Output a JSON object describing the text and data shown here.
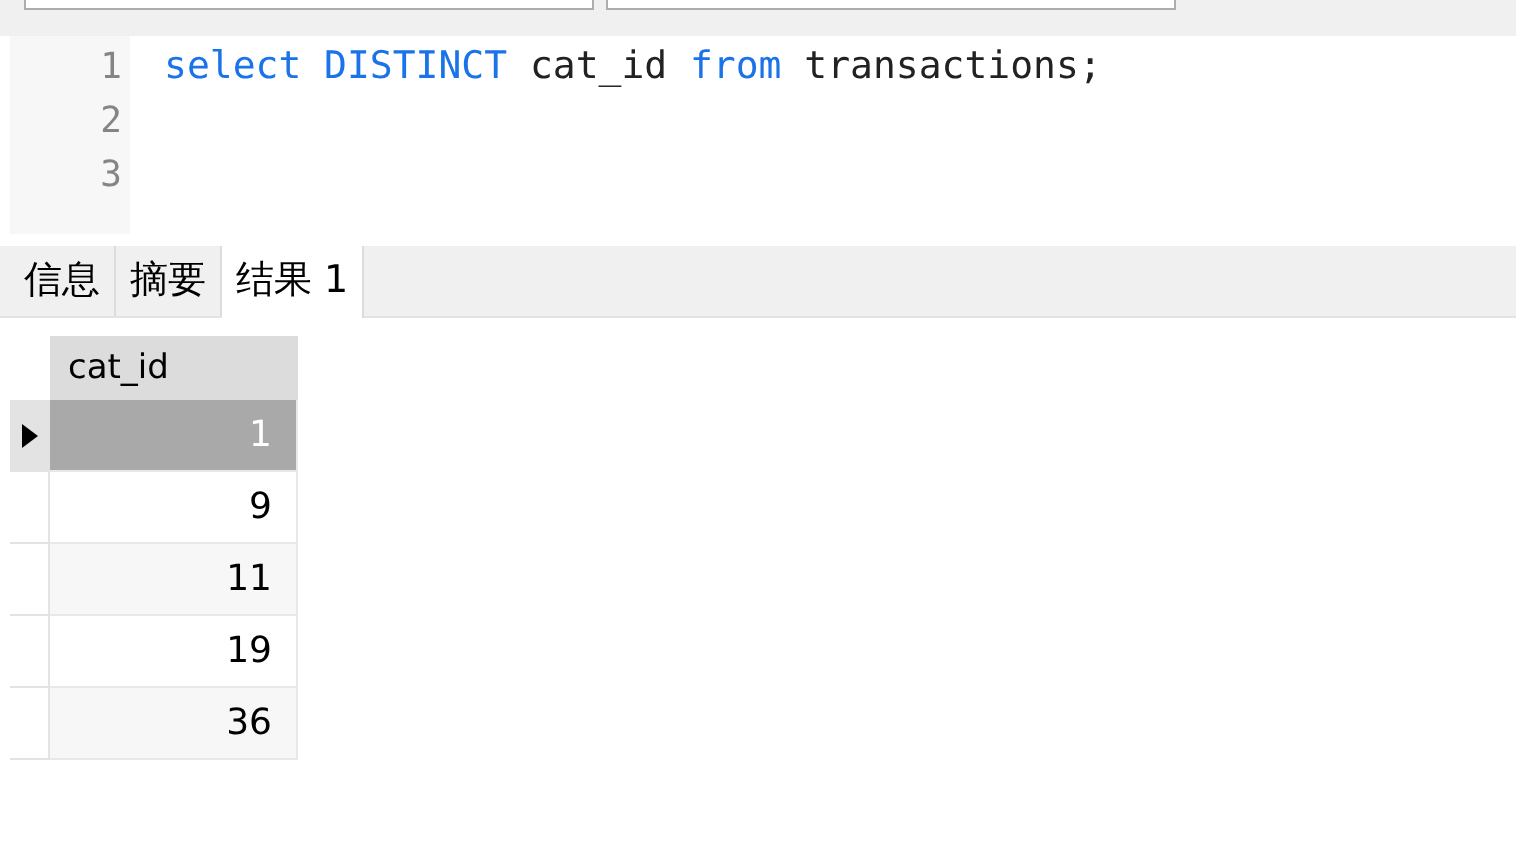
{
  "editor": {
    "lines": [
      {
        "number": "1",
        "tokens": [
          {
            "text": "select",
            "kind": "keyword"
          },
          {
            "text": "DISTINCT",
            "kind": "keyword"
          },
          {
            "text": "cat_id",
            "kind": "plain"
          },
          {
            "text": "from",
            "kind": "keyword"
          },
          {
            "text": "transactions;",
            "kind": "plain"
          }
        ]
      },
      {
        "number": "2"
      },
      {
        "number": "3"
      }
    ]
  },
  "tabs": [
    {
      "label": "信息",
      "selected": false
    },
    {
      "label": "摘要",
      "selected": false
    },
    {
      "label": "结果 1",
      "selected": true
    }
  ],
  "table": {
    "columns": [
      "cat_id"
    ],
    "rows": [
      {
        "cells": [
          "1"
        ],
        "selected": true
      },
      {
        "cells": [
          "9"
        ],
        "selected": false
      },
      {
        "cells": [
          "11"
        ],
        "selected": false
      },
      {
        "cells": [
          "19"
        ],
        "selected": false
      },
      {
        "cells": [
          "36"
        ],
        "selected": false
      }
    ]
  }
}
